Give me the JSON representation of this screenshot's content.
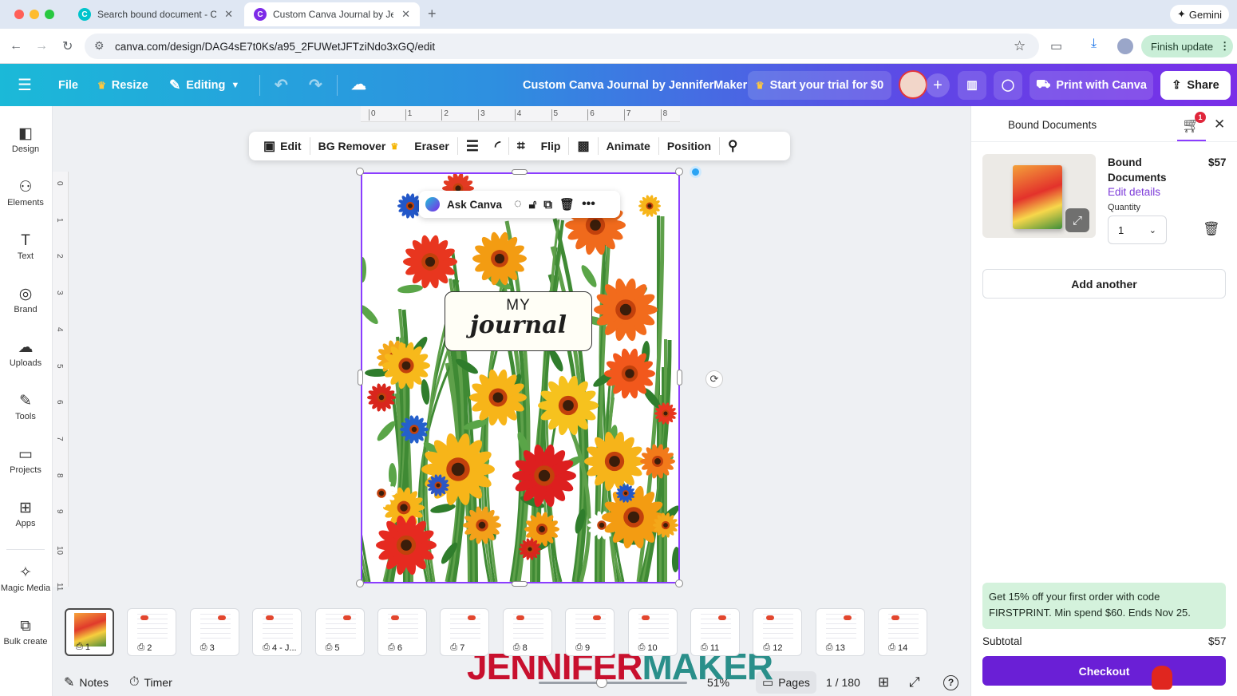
{
  "browser": {
    "tabs": [
      {
        "label": "Search bound document - Ca",
        "active": false
      },
      {
        "label": "Custom Canva Journal by Jen",
        "active": true
      }
    ],
    "new_tab_glyph": "+",
    "gemini_label": "Gemini",
    "url": "canva.com/design/DAG4sE7t0Ks/a95_2FUWetJFTziNdo3xGQ/edit",
    "finish_update_label": "Finish update"
  },
  "header": {
    "file_label": "File",
    "resize_label": "Resize",
    "editing_label": "Editing",
    "doc_title": "Custom Canva Journal by JenniferMaker",
    "trial_label": "Start your trial for $0",
    "print_label": "Print with Canva",
    "share_label": "Share"
  },
  "sidebar": {
    "items": [
      {
        "label": "Design",
        "icon": "design-icon"
      },
      {
        "label": "Elements",
        "icon": "elements-icon"
      },
      {
        "label": "Text",
        "icon": "text-icon"
      },
      {
        "label": "Brand",
        "icon": "brand-icon"
      },
      {
        "label": "Uploads",
        "icon": "uploads-icon"
      },
      {
        "label": "Tools",
        "icon": "tools-icon"
      },
      {
        "label": "Projects",
        "icon": "projects-icon"
      },
      {
        "label": "Apps",
        "icon": "apps-icon"
      },
      {
        "label": "Magic Media",
        "icon": "magic-media-icon"
      },
      {
        "label": "Bulk create",
        "icon": "bulk-create-icon"
      }
    ]
  },
  "rulers": {
    "top": [
      "0",
      "1",
      "2",
      "3",
      "4",
      "5",
      "6",
      "7",
      "8"
    ],
    "left": [
      "0",
      "1",
      "2",
      "3",
      "4",
      "5",
      "6",
      "7",
      "8",
      "9",
      "10",
      "11"
    ]
  },
  "context_toolbar": {
    "edit": "Edit",
    "bg_remover": "BG Remover",
    "eraser": "Eraser",
    "flip": "Flip",
    "animate": "Animate",
    "position": "Position"
  },
  "ask_canva": {
    "label": "Ask Canva"
  },
  "canvas": {
    "title_line1": "MY",
    "title_line2": "journal"
  },
  "panel": {
    "title": "Bound Documents",
    "cart_count": "1",
    "product_name": "Bound Documents",
    "product_price": "$57",
    "edit_details": "Edit details",
    "quantity_label": "Quantity",
    "quantity_value": "1",
    "add_another": "Add another",
    "promo": "Get 15% off your first order with code FIRSTPRINT. Min spend $60. Ends Nov 25.",
    "subtotal_label": "Subtotal",
    "subtotal_value": "$57",
    "checkout_label": "Checkout"
  },
  "pages": {
    "thumbs": [
      "1",
      "2",
      "3",
      "4 - J...",
      "5",
      "6",
      "7",
      "8",
      "9",
      "10",
      "11",
      "12",
      "13",
      "14"
    ],
    "selected_index": 0
  },
  "footer": {
    "notes_label": "Notes",
    "timer_label": "Timer",
    "zoom": "51%",
    "pages_label": "Pages",
    "page_counter": "1 / 180",
    "help_glyph": "?"
  },
  "watermark": {
    "part1": "JENNIFER",
    "part2": "MAKER"
  },
  "colors": {
    "accent": "#8b3dff",
    "checkout": "#6a1fd6",
    "promo_bg": "#d4f2dc",
    "link": "#7c3ad9",
    "watermark_red": "#c8102e",
    "watermark_teal": "#2a8f8a"
  }
}
